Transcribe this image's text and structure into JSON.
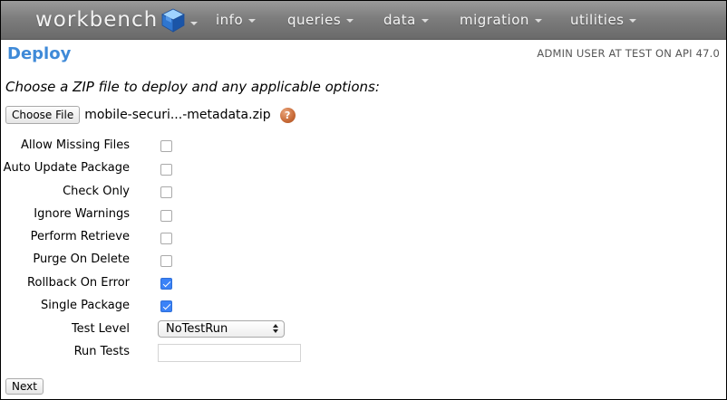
{
  "nav": {
    "brand": "workbench",
    "items": [
      {
        "label": "info"
      },
      {
        "label": "queries"
      },
      {
        "label": "data"
      },
      {
        "label": "migration"
      },
      {
        "label": "utilities"
      }
    ]
  },
  "header": {
    "title": "Deploy",
    "user_info": "ADMIN USER AT TEST ON API 47.0"
  },
  "form": {
    "instructions": "Choose a ZIP file to deploy and any applicable options:",
    "choose_file_label": "Choose File",
    "file_name": "mobile-securi...-metadata.zip",
    "help_glyph": "?",
    "options": [
      {
        "label": "Allow Missing Files",
        "checked": false
      },
      {
        "label": "Auto Update Package",
        "checked": false
      },
      {
        "label": "Check Only",
        "checked": false
      },
      {
        "label": "Ignore Warnings",
        "checked": false
      },
      {
        "label": "Perform Retrieve",
        "checked": false
      },
      {
        "label": "Purge On Delete",
        "checked": false
      },
      {
        "label": "Rollback On Error",
        "checked": true
      },
      {
        "label": "Single Package",
        "checked": true
      }
    ],
    "test_level_label": "Test Level",
    "test_level_value": "NoTestRun",
    "run_tests_label": "Run Tests",
    "run_tests_value": "",
    "next_label": "Next"
  },
  "colors": {
    "title": "#3f8ad8",
    "checked": "#3a82f7",
    "help_icon": "#c86a37"
  }
}
